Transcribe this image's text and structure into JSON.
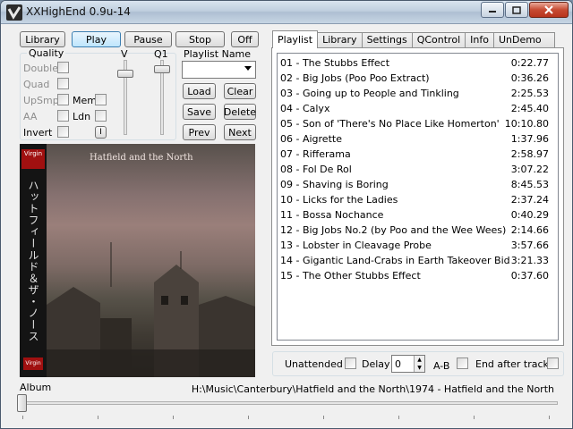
{
  "window": {
    "title": "XXHighEnd 0.9u-14"
  },
  "toolbar": {
    "library": "Library",
    "play": "Play",
    "pause": "Pause",
    "stop": "Stop",
    "off": "Off"
  },
  "quality": {
    "group_label": "Quality",
    "double": "Double",
    "quad": "Quad",
    "upsmp": "UpSmp",
    "aa": "AA",
    "invert": "Invert",
    "mem": "Mem",
    "ldn": "Ldn",
    "i_button": "I",
    "v_label": "V",
    "q1_label": "Q1",
    "v_level": 0.15,
    "q1_level": 0.08
  },
  "playlist_controls": {
    "name_label": "Playlist Name",
    "name_value": "",
    "load": "Load",
    "clear": "Clear",
    "save": "Save",
    "delete": "Delete",
    "prev": "Prev",
    "next": "Next"
  },
  "album_art": {
    "cover_title": "Hatfield and the North",
    "spine_text": "ハットフィールド＆ザ・ノース",
    "logo_text": "Virgin"
  },
  "tabs": [
    "Playlist",
    "Library",
    "Settings",
    "QControl",
    "Info",
    "UnDemo"
  ],
  "tracks": [
    {
      "title": "01 - The Stubbs Effect",
      "duration": "0:22.77"
    },
    {
      "title": "02 - Big Jobs (Poo Poo Extract)",
      "duration": "0:36.26"
    },
    {
      "title": "03 - Going up to People and Tinkling",
      "duration": "2:25.53"
    },
    {
      "title": "04 - Calyx",
      "duration": "2:45.40"
    },
    {
      "title": "05 - Son of 'There's No Place Like Homerton'",
      "duration": "10:10.80"
    },
    {
      "title": "06 - Aigrette",
      "duration": "1:37.96"
    },
    {
      "title": "07 - Rifferama",
      "duration": "2:58.97"
    },
    {
      "title": "08 - Fol De Rol",
      "duration": "3:07.22"
    },
    {
      "title": "09 - Shaving is Boring",
      "duration": "8:45.53"
    },
    {
      "title": "10 - Licks for the Ladies",
      "duration": "2:37.24"
    },
    {
      "title": "11 - Bossa Nochance",
      "duration": "0:40.29"
    },
    {
      "title": "12 - Big Jobs No.2 (by Poo and the Wee Wees)",
      "duration": "2:14.66"
    },
    {
      "title": "13 - Lobster in Cleavage Probe",
      "duration": "3:57.66"
    },
    {
      "title": "14 - Gigantic Land-Crabs in Earth Takeover Bid",
      "duration": "3:21.33"
    },
    {
      "title": "15 - The Other Stubbs Effect",
      "duration": "0:37.60"
    }
  ],
  "bottom_options": {
    "unattended": "Unattended",
    "delay": "Delay",
    "delay_value": "0",
    "ab": "A-B",
    "end_after_track": "End after track"
  },
  "status": {
    "album_label": "Album",
    "path": "H:\\Music\\Canterbury\\Hatfield and the North\\1974 - Hatfield and the North",
    "position": 0.0
  }
}
